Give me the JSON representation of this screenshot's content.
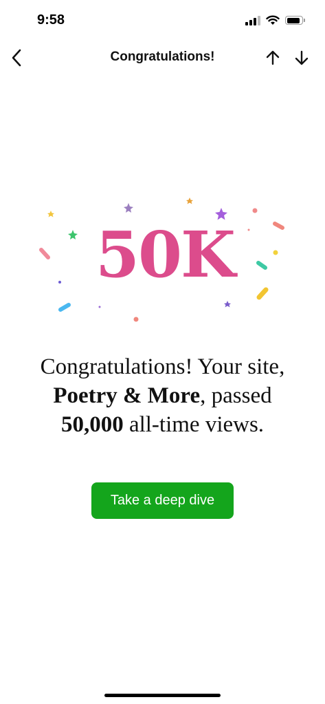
{
  "status_bar": {
    "time": "9:58",
    "icons": [
      "signal-icon",
      "wifi-icon",
      "battery-icon"
    ]
  },
  "nav": {
    "title": "Congratulations!",
    "icons": [
      "back-chevron-icon",
      "arrow-up-icon",
      "arrow-down-icon"
    ]
  },
  "badge": {
    "text": "50K",
    "color": "#dc4c8c"
  },
  "message": {
    "part1": "Congratulations! Your site, ",
    "site_name": "Poetry & More",
    "part2": ", passed ",
    "count": "50,000",
    "part3": " all-time views."
  },
  "cta": {
    "label": "Take a deep dive",
    "color": "#14a51c"
  }
}
